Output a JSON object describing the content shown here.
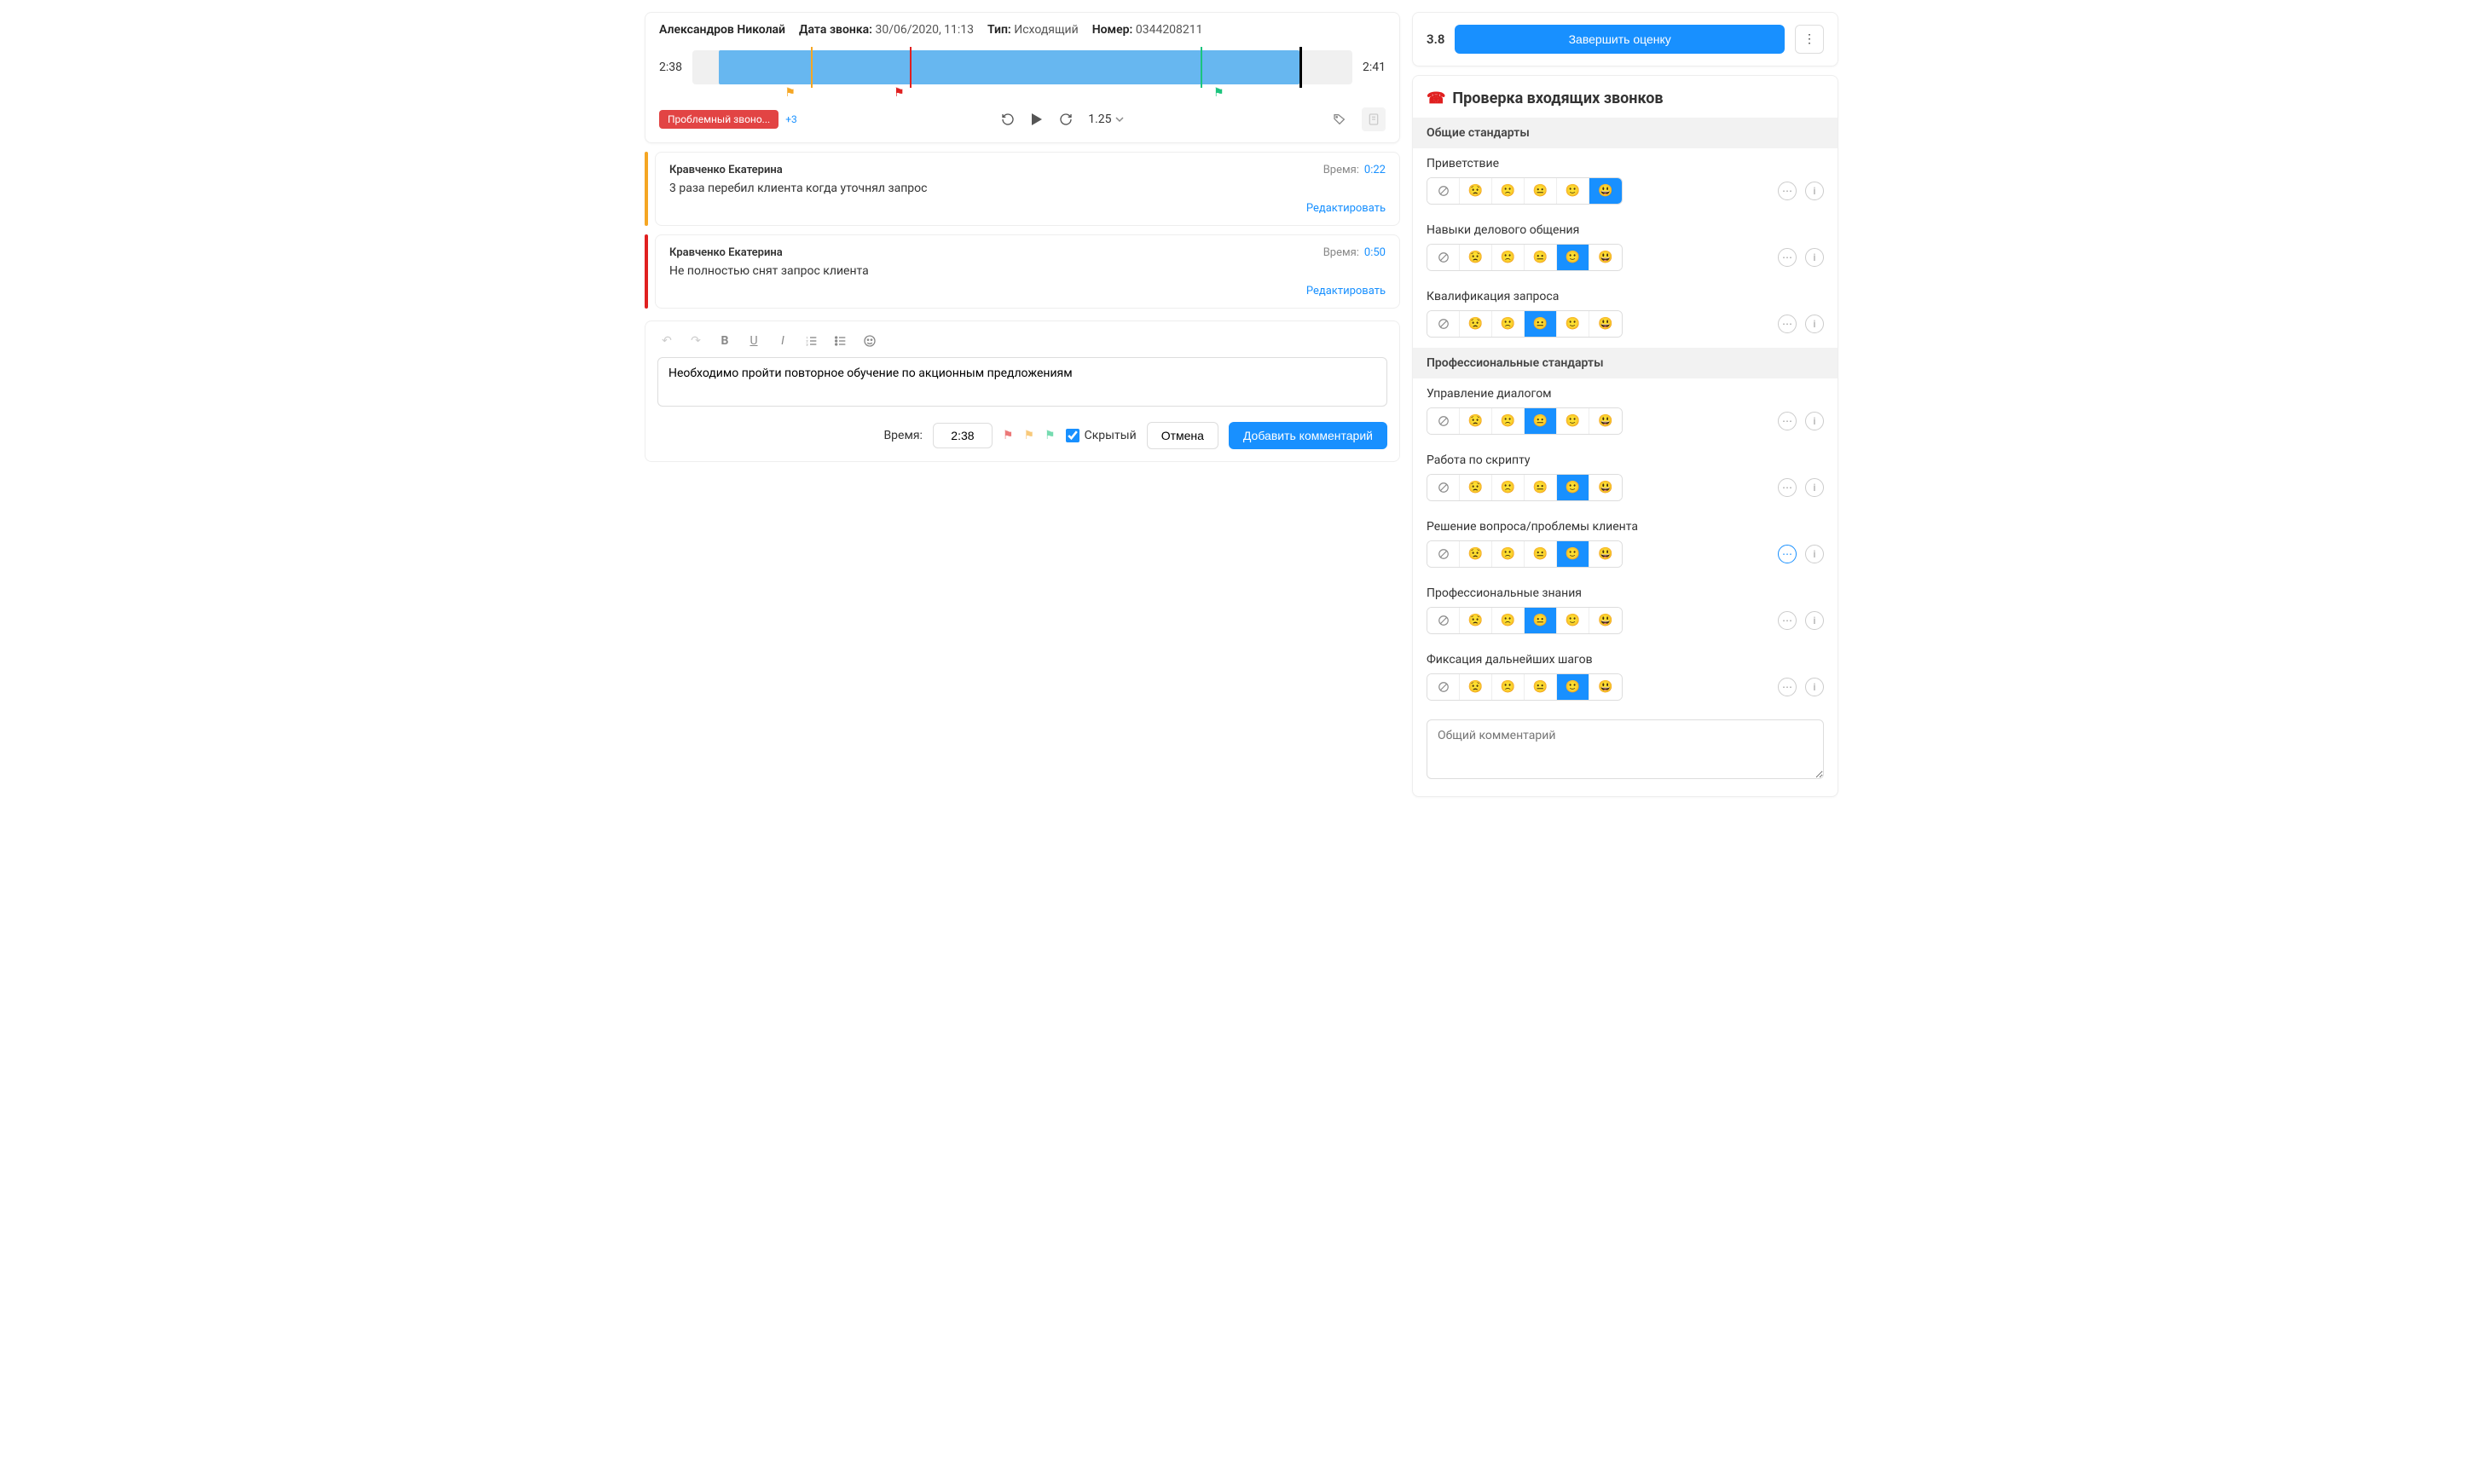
{
  "meta": {
    "agent": "Александров Николай",
    "date_label": "Дата звонка:",
    "date": "30/06/2020, 11:13",
    "type_label": "Тип:",
    "type": "Исходящий",
    "number_label": "Номер:",
    "number": "0344208211"
  },
  "player": {
    "time_current": "2:38",
    "time_total": "2:41",
    "speed": "1.25",
    "tag": "Проблемный звоно...",
    "more_tags": "+3",
    "markers": [
      {
        "color": "orange",
        "pos": 18
      },
      {
        "color": "red",
        "pos": 33
      },
      {
        "color": "green",
        "pos": 77
      },
      {
        "color": "black",
        "pos": 92
      }
    ]
  },
  "comments": [
    {
      "color": "orange",
      "author": "Кравченко Екатерина",
      "time_label": "Время:",
      "time": "0:22",
      "text": "3 раза перебил клиента когда уточнял запрос",
      "edit": "Редактировать"
    },
    {
      "color": "red",
      "author": "Кравченко Екатерина",
      "time_label": "Время:",
      "time": "0:50",
      "text": "Не полностью снят запрос клиента",
      "edit": "Редактировать"
    }
  ],
  "editor": {
    "text": "Необходимо пройти повторное обучение по акционным предложениям",
    "time_label": "Время:",
    "time_value": "2:38",
    "hidden_label": "Скрытый",
    "cancel": "Отмена",
    "submit": "Добавить комментарий"
  },
  "eval": {
    "score": "3.8",
    "finish": "Завершить оценку",
    "title": "Проверка входящих звонков",
    "groups": [
      {
        "name": "Общие стандарты",
        "criteria": [
          {
            "name": "Приветствие",
            "selected": 5,
            "comment_active": false
          },
          {
            "name": "Навыки делового общения",
            "selected": 4,
            "comment_active": false
          },
          {
            "name": "Квалификация запроса",
            "selected": 3,
            "comment_active": false
          }
        ]
      },
      {
        "name": "Профессиональные стандарты",
        "criteria": [
          {
            "name": "Управление диалогом",
            "selected": 3,
            "comment_active": false
          },
          {
            "name": "Работа по скрипту",
            "selected": 4,
            "comment_active": false
          },
          {
            "name": "Решение вопроса/проблемы клиента",
            "selected": 4,
            "comment_active": true
          },
          {
            "name": "Профессиональные знания",
            "selected": 3,
            "comment_active": false
          },
          {
            "name": "Фиксация дальнейших шагов",
            "selected": 4,
            "comment_active": false
          }
        ]
      }
    ],
    "general_placeholder": "Общий комментарий"
  },
  "emoji": [
    "😟",
    "🙁",
    "😐",
    "🙂",
    "😃"
  ]
}
